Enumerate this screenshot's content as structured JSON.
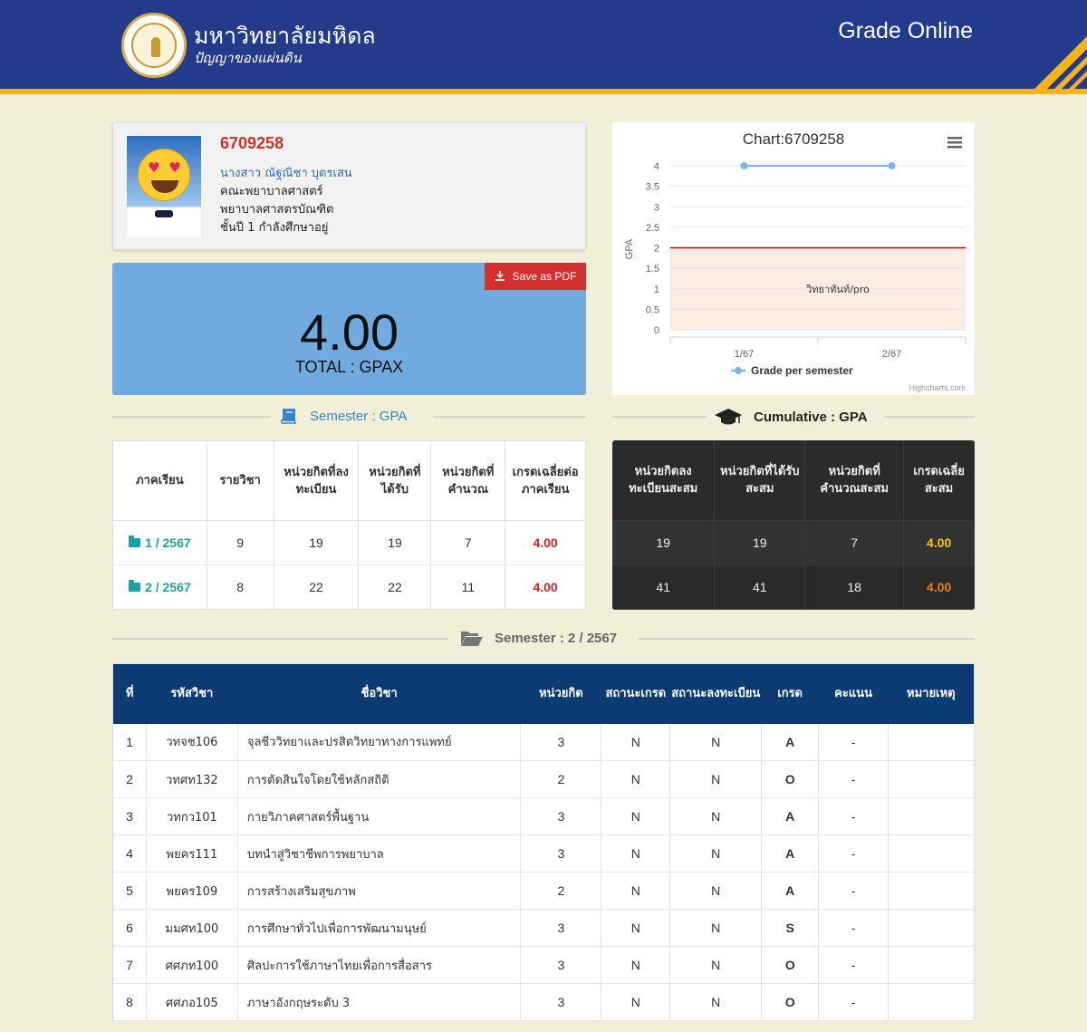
{
  "header": {
    "university_name": "มหาวิทยาลัยมหิดล",
    "motto": "ปัญญาของแผ่นดิน",
    "brand": "Grade Online",
    "colors": {
      "header_bg": "#233b8a",
      "accent": "#f4b41a"
    }
  },
  "profile": {
    "student_id": "6709258",
    "name": "นางสาว ณัฐณิชา บุตรเสน",
    "faculty": "คณะพยาบาลศาสตร์",
    "program": "พยาบาลศาสตรบัณฑิต",
    "status": "ชั้นปี 1 กำลังศึกษาอยู่"
  },
  "gpax": {
    "value": "4.00",
    "label": "TOTAL : GPAX",
    "pdf_button": "Save as PDF"
  },
  "chart_data": {
    "type": "line",
    "title": "Chart:6709258",
    "categories": [
      "1/67",
      "2/67"
    ],
    "series": [
      {
        "name": "Grade per semester",
        "values": [
          4,
          4
        ]
      }
    ],
    "ylabel": "GPA",
    "ylim": [
      0,
      4
    ],
    "yticks": [
      "0",
      "0.5",
      "1",
      "1.5",
      "2",
      "2.5",
      "3",
      "3.5",
      "4"
    ],
    "threshold": 2,
    "band_label": "วิทยาทันท์/pro",
    "credit": "Highcharts.com",
    "colors": {
      "series": "#7cb5ec",
      "threshold": "#cc0000",
      "band": "#fdece4"
    }
  },
  "semester_section": {
    "title": "Semester : GPA",
    "headers": [
      "ภาคเรียน",
      "รายวิชา",
      "หน่วยกิตที่ลงทะเบียน",
      "หน่วยกิตที่ได้รับ",
      "หน่วยกิตที่คำนวณ",
      "เกรดเฉลี่ยต่อภาคเรียน"
    ],
    "rows": [
      {
        "semester": "1 / 2567",
        "courses": "9",
        "registered": "19",
        "earned": "19",
        "calculated": "7",
        "gpa": "4.00"
      },
      {
        "semester": "2 / 2567",
        "courses": "8",
        "registered": "22",
        "earned": "22",
        "calculated": "11",
        "gpa": "4.00"
      }
    ]
  },
  "cumulative_section": {
    "title": "Cumulative : GPA",
    "headers": [
      "หน่วยกิตลงทะเบียนสะสม",
      "หน่วยกิตที่ได้รับสะสม",
      "หน่วยกิตที่คำนวณสะสม",
      "เกรดเฉลี่ยสะสม"
    ],
    "rows": [
      {
        "registered": "19",
        "earned": "19",
        "calculated": "7",
        "gpa": "4.00",
        "gpa_color": "#f5c518"
      },
      {
        "registered": "41",
        "earned": "41",
        "calculated": "18",
        "gpa": "4.00",
        "gpa_color": "#f07a1a"
      }
    ]
  },
  "course_section": {
    "title": "Semester : 2 / 2567",
    "headers": [
      "ที่",
      "รหัสวิชา",
      "ชื่อวิชา",
      "หน่วยกิต",
      "สถานะเกรด",
      "สถานะลงทะเบียน",
      "เกรด",
      "คะแนน",
      "หมายเหตุ"
    ],
    "rows": [
      {
        "no": "1",
        "code": "วทจช106",
        "name": "จุลชีววิทยาและปรสิตวิทยาทางการแพทย์",
        "credit": "3",
        "grade_status": "N",
        "reg_status": "N",
        "grade": "A",
        "score": "-",
        "note": ""
      },
      {
        "no": "2",
        "code": "วทศท132",
        "name": "การตัดสินใจโดยใช้หลักสถิติ",
        "credit": "2",
        "grade_status": "N",
        "reg_status": "N",
        "grade": "O",
        "score": "-",
        "note": ""
      },
      {
        "no": "3",
        "code": "วทกว101",
        "name": "กายวิภาคศาสตร์พื้นฐาน",
        "credit": "3",
        "grade_status": "N",
        "reg_status": "N",
        "grade": "A",
        "score": "-",
        "note": ""
      },
      {
        "no": "4",
        "code": "พยคร111",
        "name": "บทนำสู่วิชาชีพการพยาบาล",
        "credit": "3",
        "grade_status": "N",
        "reg_status": "N",
        "grade": "A",
        "score": "-",
        "note": ""
      },
      {
        "no": "5",
        "code": "พยคร109",
        "name": "การสร้างเสริมสุขภาพ",
        "credit": "2",
        "grade_status": "N",
        "reg_status": "N",
        "grade": "A",
        "score": "-",
        "note": ""
      },
      {
        "no": "6",
        "code": "มมศท100",
        "name": "การศึกษาทั่วไปเพื่อการพัฒนามนุษย์",
        "credit": "3",
        "grade_status": "N",
        "reg_status": "N",
        "grade": "S",
        "score": "-",
        "note": ""
      },
      {
        "no": "7",
        "code": "ศศภท100",
        "name": "ศิลปะการใช้ภาษาไทยเพื่อการสื่อสาร",
        "credit": "3",
        "grade_status": "N",
        "reg_status": "N",
        "grade": "O",
        "score": "-",
        "note": ""
      },
      {
        "no": "8",
        "code": "ศศภอ105",
        "name": "ภาษาอังกฤษระดับ 3",
        "credit": "3",
        "grade_status": "N",
        "reg_status": "N",
        "grade": "O",
        "score": "-",
        "note": ""
      }
    ]
  }
}
